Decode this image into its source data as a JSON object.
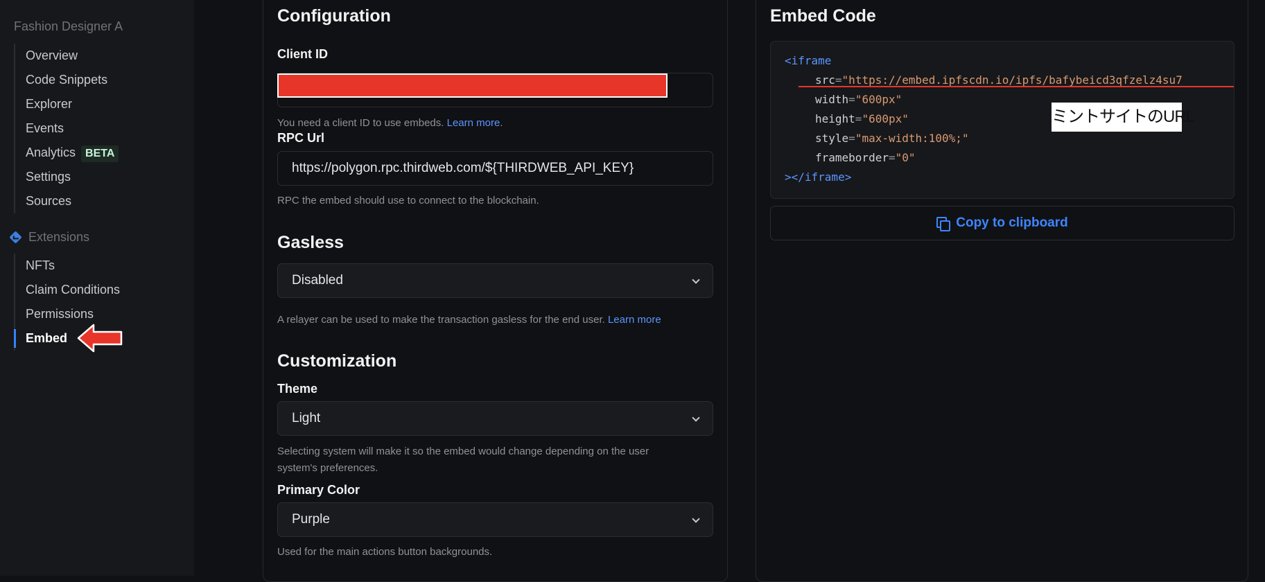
{
  "sidebar": {
    "project_name": "Fashion Designer A",
    "items": [
      {
        "label": "Overview"
      },
      {
        "label": "Code Snippets"
      },
      {
        "label": "Explorer"
      },
      {
        "label": "Events"
      },
      {
        "label": "Analytics",
        "badge": "BETA"
      },
      {
        "label": "Settings"
      },
      {
        "label": "Sources"
      }
    ],
    "extensions_label": "Extensions",
    "extensions": [
      {
        "label": "NFTs"
      },
      {
        "label": "Claim Conditions"
      },
      {
        "label": "Permissions"
      },
      {
        "label": "Embed",
        "active": true
      }
    ]
  },
  "config": {
    "title": "Configuration",
    "client_id_label": "Client ID",
    "client_id_help": "You need a client ID to use embeds. ",
    "client_id_link": "Learn more",
    "client_id_help_end": ".",
    "rpc_label": "RPC Url",
    "rpc_value": "https://polygon.rpc.thirdweb.com/${THIRDWEB_API_KEY}",
    "rpc_help": "RPC the embed should use to connect to the blockchain.",
    "gasless_title": "Gasless",
    "gasless_value": "Disabled",
    "gasless_help": "A relayer can be used to make the transaction gasless for the end user. ",
    "gasless_link": "Learn more",
    "custom_title": "Customization",
    "theme_label": "Theme",
    "theme_value": "Light",
    "theme_help_1": "Selecting system will make it so the embed would change depending on the user",
    "theme_help_2": "system's preferences.",
    "color_label": "Primary Color",
    "color_value": "Purple",
    "color_help": "Used for the main actions button backgrounds."
  },
  "embed": {
    "title": "Embed Code",
    "code": {
      "open_tag": "<iframe",
      "src_attr": "src",
      "src_value": "\"https://embed.ipfscdn.io/ipfs/bafybeicd3qfzelz4su7",
      "width_attr": "width",
      "width_value": "\"600px\"",
      "height_attr": "height",
      "height_value": "\"600px\"",
      "style_attr": "style",
      "style_value": "\"max-width:100%;\"",
      "frameborder_attr": "frameborder",
      "frameborder_value": "\"0\"",
      "close_tag": "></iframe>"
    },
    "annotation": "ミントサイトのURL",
    "copy_label": "Copy to clipboard"
  },
  "colors": {
    "accent": "#3d86ff",
    "annotation_red": "#e8352a"
  }
}
